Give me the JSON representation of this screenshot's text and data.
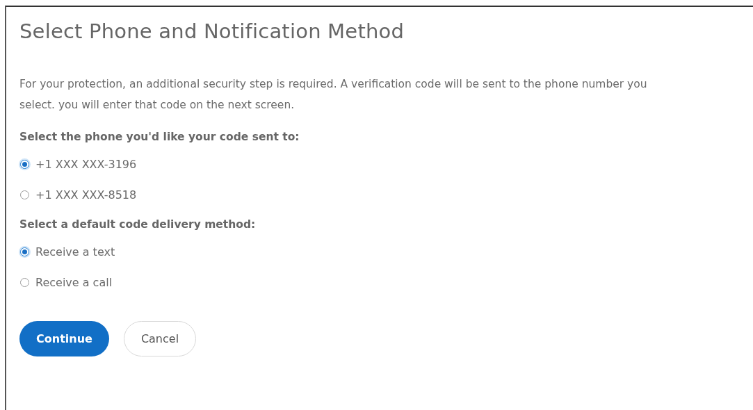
{
  "title": "Select Phone and Notification Method",
  "description": "For your protection, an additional security step is required. A verification code will be sent to the phone number you select. you will enter that code on the next screen.",
  "groups": [
    {
      "label": "Select the phone you'd like your code sent to:",
      "options": [
        {
          "label": "+1 XXX XXX-3196",
          "selected": true
        },
        {
          "label": "+1 XXX XXX-8518",
          "selected": false
        }
      ]
    },
    {
      "label": "Select a default code delivery method:",
      "options": [
        {
          "label": "Receive a text",
          "selected": true
        },
        {
          "label": "Receive a call",
          "selected": false
        }
      ]
    }
  ],
  "buttons": [
    {
      "label": "Continue",
      "kind": "primary"
    },
    {
      "label": "Cancel",
      "kind": "secondary"
    }
  ]
}
